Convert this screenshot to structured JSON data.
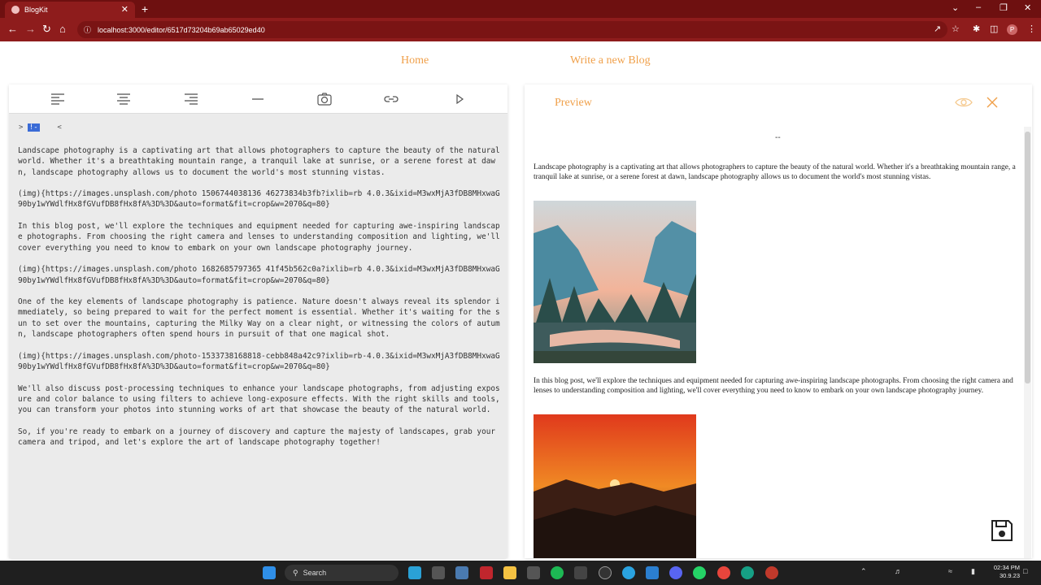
{
  "browser": {
    "tab_title": "BlogKit",
    "tab_close": "✕",
    "new_tab": "+",
    "url": "localhost:3000/editor/6517d73204b69ab65029ed40",
    "profile_initial": "P",
    "win_min": "–",
    "win_max": "❐",
    "win_close": "✕",
    "chevron": "⌄"
  },
  "nav": {
    "home": "Home",
    "write": "Write a new Blog"
  },
  "editor": {
    "toolbar_icons": [
      "align-left-icon",
      "align-center-icon",
      "align-right-icon",
      "horizontal-rule-icon",
      "camera-icon",
      "link-icon",
      "play-icon"
    ],
    "cursor_prefix": ">",
    "cursor_selected": "!-",
    "cursor_suffix": "<",
    "paragraphs": [
      "Landscape photography is a captivating art that allows photographers to capture the beauty of the natural world. Whether it's a breathtaking mountain range, a tranquil lake at sunrise, or a serene forest at dawn, landscape photography allows us to document the world's most stunning vistas.",
      "(img){https://images.unsplash.com/photo 1506744038136 46273834b3fb?ixlib=rb 4.0.3&ixid=M3wxMjA3fDB8MHxwaG90by1wYWdlfHx8fGVufDB8fHx8fA%3D%3D&auto=format&fit=crop&w=2070&q=80}",
      "In this blog post, we'll explore the techniques and equipment needed for capturing awe-inspiring landscape photographs. From choosing the right camera and lenses to understanding composition and lighting, we'll cover everything you need to know to embark on your own landscape photography journey.",
      "(img){https://images.unsplash.com/photo 1682685797365 41f45b562c0a?ixlib=rb 4.0.3&ixid=M3wxMjA3fDB8MHxwaG90by1wYWdlfHx8fGVufDB8fHx8fA%3D%3D&auto=format&fit=crop&w=2070&q=80}",
      "One of the key elements of landscape photography is patience. Nature doesn't always reveal its splendor immediately, so being prepared to wait for the perfect moment is essential. Whether it's waiting for the sun to set over the mountains, capturing the Milky Way on a clear night, or witnessing the colors of autumn, landscape photographers often spend hours in pursuit of that one magical shot.",
      "(img){https://images.unsplash.com/photo-1533738168818-cebb848a42c9?ixlib=rb-4.0.3&ixid=M3wxMjA3fDB8MHxwaG90by1wYWdlfHx8fGVufDB8fHx8fA%3D%3D&auto=format&fit=crop&w=2070&q=80}",
      "We'll also discuss post-processing techniques to enhance your landscape photographs, from adjusting exposure and color balance to using filters to achieve long-exposure effects. With the right skills and tools, you can transform your photos into stunning works of art that showcase the beauty of the natural world.",
      "So, if you're ready to embark on a journey of discovery and capture the majesty of landscapes, grab your camera and tripod, and let's explore the art of landscape photography together!"
    ]
  },
  "preview": {
    "title": "Preview",
    "dash": "--",
    "para1": "Landscape photography is a captivating art that allows photographers to capture the beauty of the natural world. Whether it's a breathtaking mountain range, a tranquil lake at sunrise, or a serene forest at dawn, landscape photography allows us to document the world's most stunning vistas.",
    "para2": "In this blog post, we'll explore the techniques and equipment needed for capturing awe-inspiring landscape photographs. From choosing the right camera and lenses to understanding composition and lighting, we'll cover everything you need to know to embark on your own landscape photography journey."
  },
  "taskbar": {
    "search_label": "Search",
    "time": "02:34 PM",
    "date": "30.9.23"
  },
  "colors": {
    "accent": "#f0a04a",
    "chrome": "#8e1c1c"
  }
}
